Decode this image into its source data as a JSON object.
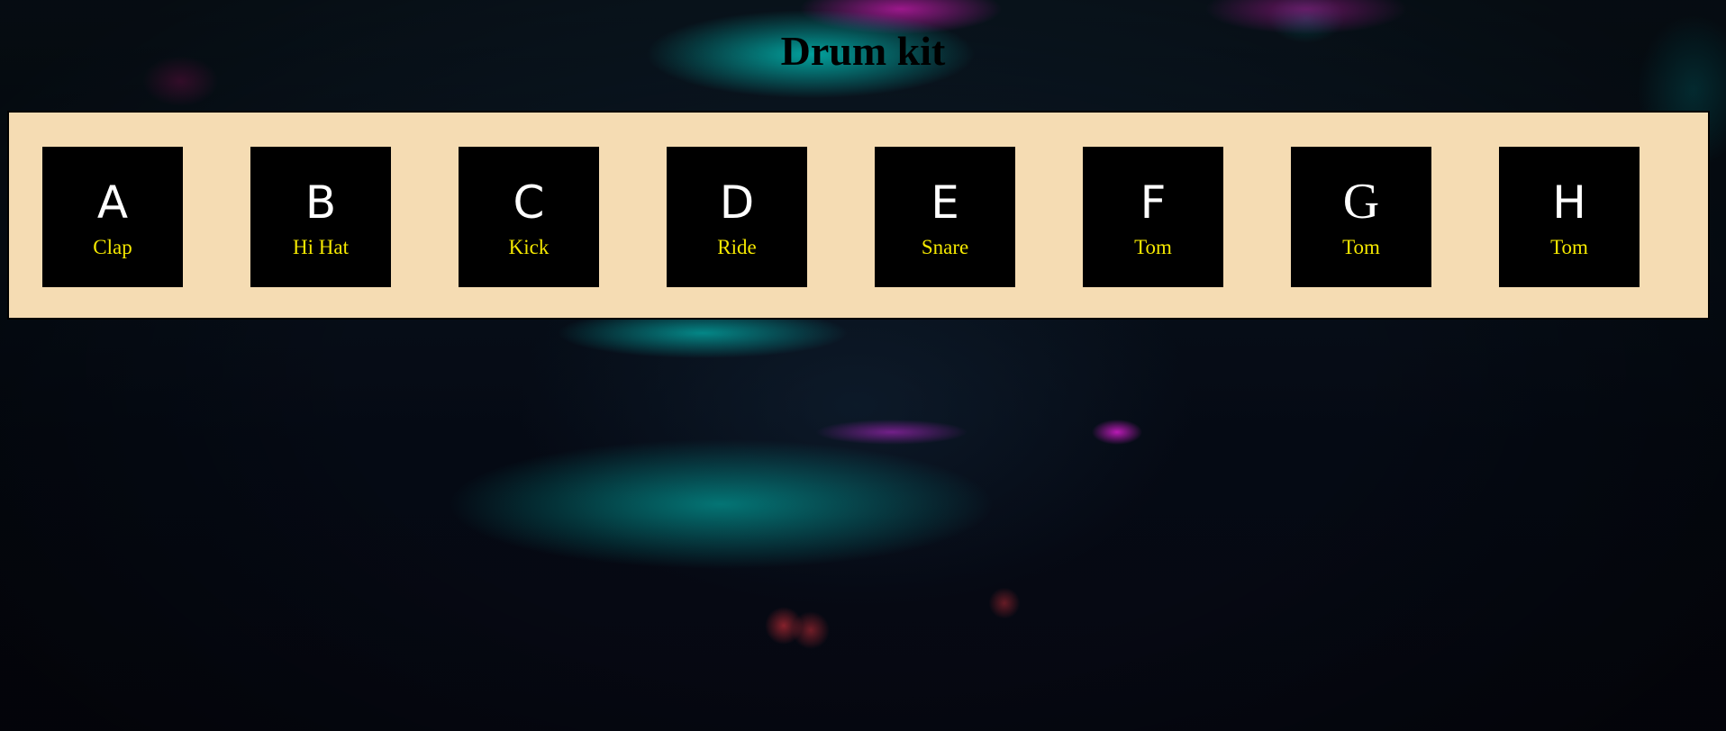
{
  "page": {
    "title": "Drum kit",
    "accent_color": "#f5dcb3",
    "pad_color": "#000000",
    "label_color": "#f5e800"
  },
  "pads": [
    {
      "key": "A",
      "sound": "Clap"
    },
    {
      "key": "B",
      "sound": "Hi Hat"
    },
    {
      "key": "C",
      "sound": "Kick"
    },
    {
      "key": "D",
      "sound": "Ride"
    },
    {
      "key": "E",
      "sound": "Snare"
    },
    {
      "key": "F",
      "sound": "Tom"
    },
    {
      "key": "G",
      "sound": "Tom"
    },
    {
      "key": "H",
      "sound": "Tom"
    }
  ]
}
